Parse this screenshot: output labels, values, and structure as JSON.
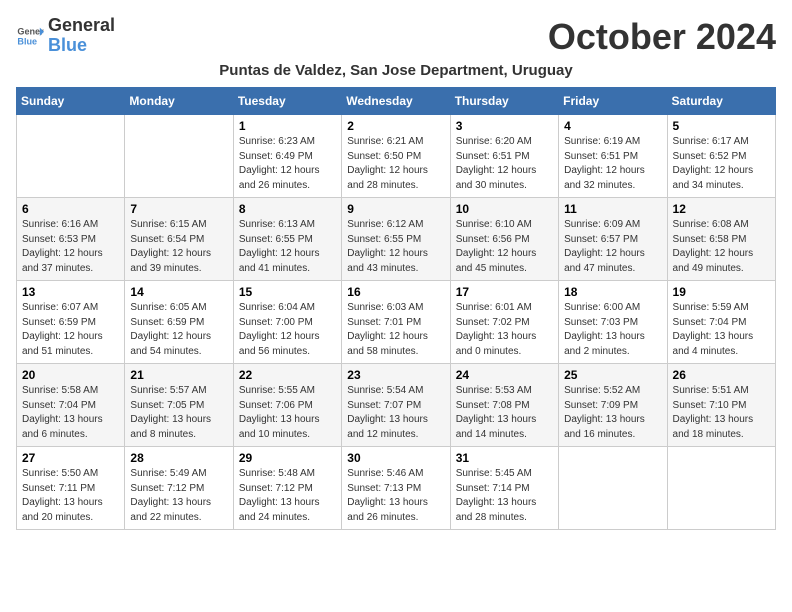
{
  "header": {
    "logo_general": "General",
    "logo_blue": "Blue",
    "month_title": "October 2024",
    "subtitle": "Puntas de Valdez, San Jose Department, Uruguay"
  },
  "weekdays": [
    "Sunday",
    "Monday",
    "Tuesday",
    "Wednesday",
    "Thursday",
    "Friday",
    "Saturday"
  ],
  "weeks": [
    [
      {
        "day": "",
        "detail": ""
      },
      {
        "day": "",
        "detail": ""
      },
      {
        "day": "1",
        "detail": "Sunrise: 6:23 AM\nSunset: 6:49 PM\nDaylight: 12 hours and 26 minutes."
      },
      {
        "day": "2",
        "detail": "Sunrise: 6:21 AM\nSunset: 6:50 PM\nDaylight: 12 hours and 28 minutes."
      },
      {
        "day": "3",
        "detail": "Sunrise: 6:20 AM\nSunset: 6:51 PM\nDaylight: 12 hours and 30 minutes."
      },
      {
        "day": "4",
        "detail": "Sunrise: 6:19 AM\nSunset: 6:51 PM\nDaylight: 12 hours and 32 minutes."
      },
      {
        "day": "5",
        "detail": "Sunrise: 6:17 AM\nSunset: 6:52 PM\nDaylight: 12 hours and 34 minutes."
      }
    ],
    [
      {
        "day": "6",
        "detail": "Sunrise: 6:16 AM\nSunset: 6:53 PM\nDaylight: 12 hours and 37 minutes."
      },
      {
        "day": "7",
        "detail": "Sunrise: 6:15 AM\nSunset: 6:54 PM\nDaylight: 12 hours and 39 minutes."
      },
      {
        "day": "8",
        "detail": "Sunrise: 6:13 AM\nSunset: 6:55 PM\nDaylight: 12 hours and 41 minutes."
      },
      {
        "day": "9",
        "detail": "Sunrise: 6:12 AM\nSunset: 6:55 PM\nDaylight: 12 hours and 43 minutes."
      },
      {
        "day": "10",
        "detail": "Sunrise: 6:10 AM\nSunset: 6:56 PM\nDaylight: 12 hours and 45 minutes."
      },
      {
        "day": "11",
        "detail": "Sunrise: 6:09 AM\nSunset: 6:57 PM\nDaylight: 12 hours and 47 minutes."
      },
      {
        "day": "12",
        "detail": "Sunrise: 6:08 AM\nSunset: 6:58 PM\nDaylight: 12 hours and 49 minutes."
      }
    ],
    [
      {
        "day": "13",
        "detail": "Sunrise: 6:07 AM\nSunset: 6:59 PM\nDaylight: 12 hours and 51 minutes."
      },
      {
        "day": "14",
        "detail": "Sunrise: 6:05 AM\nSunset: 6:59 PM\nDaylight: 12 hours and 54 minutes."
      },
      {
        "day": "15",
        "detail": "Sunrise: 6:04 AM\nSunset: 7:00 PM\nDaylight: 12 hours and 56 minutes."
      },
      {
        "day": "16",
        "detail": "Sunrise: 6:03 AM\nSunset: 7:01 PM\nDaylight: 12 hours and 58 minutes."
      },
      {
        "day": "17",
        "detail": "Sunrise: 6:01 AM\nSunset: 7:02 PM\nDaylight: 13 hours and 0 minutes."
      },
      {
        "day": "18",
        "detail": "Sunrise: 6:00 AM\nSunset: 7:03 PM\nDaylight: 13 hours and 2 minutes."
      },
      {
        "day": "19",
        "detail": "Sunrise: 5:59 AM\nSunset: 7:04 PM\nDaylight: 13 hours and 4 minutes."
      }
    ],
    [
      {
        "day": "20",
        "detail": "Sunrise: 5:58 AM\nSunset: 7:04 PM\nDaylight: 13 hours and 6 minutes."
      },
      {
        "day": "21",
        "detail": "Sunrise: 5:57 AM\nSunset: 7:05 PM\nDaylight: 13 hours and 8 minutes."
      },
      {
        "day": "22",
        "detail": "Sunrise: 5:55 AM\nSunset: 7:06 PM\nDaylight: 13 hours and 10 minutes."
      },
      {
        "day": "23",
        "detail": "Sunrise: 5:54 AM\nSunset: 7:07 PM\nDaylight: 13 hours and 12 minutes."
      },
      {
        "day": "24",
        "detail": "Sunrise: 5:53 AM\nSunset: 7:08 PM\nDaylight: 13 hours and 14 minutes."
      },
      {
        "day": "25",
        "detail": "Sunrise: 5:52 AM\nSunset: 7:09 PM\nDaylight: 13 hours and 16 minutes."
      },
      {
        "day": "26",
        "detail": "Sunrise: 5:51 AM\nSunset: 7:10 PM\nDaylight: 13 hours and 18 minutes."
      }
    ],
    [
      {
        "day": "27",
        "detail": "Sunrise: 5:50 AM\nSunset: 7:11 PM\nDaylight: 13 hours and 20 minutes."
      },
      {
        "day": "28",
        "detail": "Sunrise: 5:49 AM\nSunset: 7:12 PM\nDaylight: 13 hours and 22 minutes."
      },
      {
        "day": "29",
        "detail": "Sunrise: 5:48 AM\nSunset: 7:12 PM\nDaylight: 13 hours and 24 minutes."
      },
      {
        "day": "30",
        "detail": "Sunrise: 5:46 AM\nSunset: 7:13 PM\nDaylight: 13 hours and 26 minutes."
      },
      {
        "day": "31",
        "detail": "Sunrise: 5:45 AM\nSunset: 7:14 PM\nDaylight: 13 hours and 28 minutes."
      },
      {
        "day": "",
        "detail": ""
      },
      {
        "day": "",
        "detail": ""
      }
    ]
  ]
}
